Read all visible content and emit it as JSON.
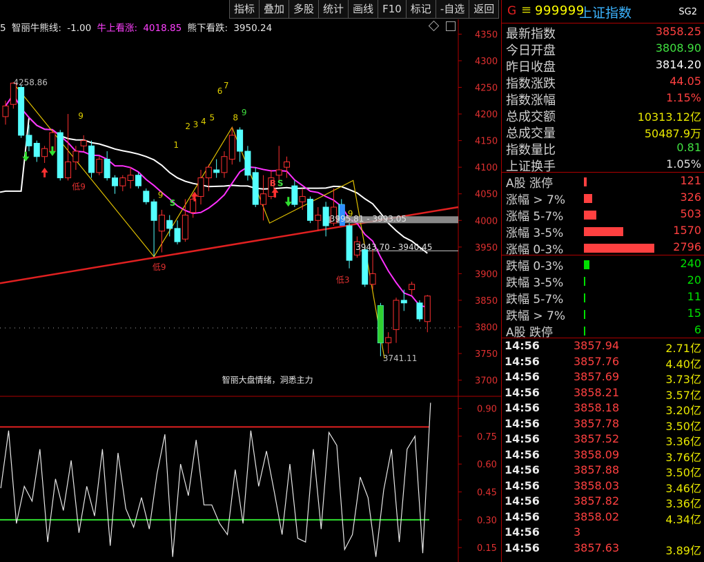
{
  "toolbar": [
    "指标",
    "叠加",
    "多股",
    "统计",
    "画线",
    "F10",
    "标记",
    "-自选",
    "返回"
  ],
  "legend": {
    "prefix": "5",
    "name": "智丽牛熊线:",
    "value": "-1.00",
    "bull_label": "牛上看涨:",
    "bull_value": "4018.85",
    "bear_label": "熊下看跌:",
    "bear_value": "3950.24"
  },
  "chart_data": {
    "type": "candlestick",
    "y_range": [
      3680,
      4370
    ],
    "y_ticks": [
      "4350",
      "4300",
      "4250",
      "4200",
      "4150",
      "4100",
      "4050",
      "4000",
      "3950",
      "3900",
      "3850",
      "3800",
      "3750",
      "3700"
    ],
    "candles": [
      [
        4195,
        4215,
        4180,
        4225
      ],
      [
        4218,
        4258,
        4210,
        4260
      ],
      [
        4250,
        4160,
        4155,
        4255
      ],
      [
        4160,
        4140,
        4130,
        4180
      ],
      [
        4145,
        4120,
        4110,
        4150
      ],
      [
        4120,
        4135,
        4108,
        4140
      ],
      [
        4130,
        4165,
        4125,
        4170
      ],
      [
        4165,
        4080,
        4075,
        4170
      ],
      [
        4080,
        4110,
        4075,
        4200
      ],
      [
        4110,
        4130,
        4095,
        4140
      ],
      [
        4140,
        4150,
        4130,
        4160
      ],
      [
        4140,
        4090,
        4080,
        4150
      ],
      [
        4090,
        4115,
        4085,
        4120
      ],
      [
        4115,
        4080,
        4075,
        4130
      ],
      [
        4080,
        4065,
        4050,
        4085
      ],
      [
        4065,
        4080,
        4055,
        4085
      ],
      [
        4075,
        4085,
        4060,
        4100
      ],
      [
        4085,
        4065,
        4060,
        4090
      ],
      [
        4055,
        4035,
        4030,
        4060
      ],
      [
        4035,
        4000,
        3932,
        4040
      ],
      [
        3980,
        4010,
        3940,
        4020
      ],
      [
        4000,
        3985,
        3970,
        4010
      ],
      [
        3985,
        3960,
        3955,
        4000
      ],
      [
        3965,
        4010,
        3960,
        4040
      ],
      [
        4015,
        4040,
        4005,
        4050
      ],
      [
        4045,
        4080,
        4030,
        4095
      ],
      [
        4080,
        4100,
        4055,
        4105
      ],
      [
        4095,
        4090,
        4080,
        4115
      ],
      [
        4090,
        4120,
        4080,
        4130
      ],
      [
        4115,
        4160,
        4105,
        4175
      ],
      [
        4170,
        4130,
        4110,
        4175
      ],
      [
        4130,
        4085,
        4075,
        4140
      ],
      [
        4090,
        4030,
        4025,
        4100
      ],
      [
        4030,
        4050,
        4000,
        4085
      ],
      [
        4045,
        4080,
        4040,
        4095
      ],
      [
        4085,
        4095,
        4070,
        4140
      ],
      [
        4100,
        4110,
        4080,
        4120
      ],
      [
        4065,
        4030,
        4025,
        4075
      ],
      [
        4035,
        4045,
        4020,
        4060
      ],
      [
        4040,
        4000,
        3995,
        4045
      ],
      [
        4000,
        4010,
        3980,
        4025
      ],
      [
        4025,
        3990,
        3970,
        4035
      ],
      [
        3995,
        4025,
        3990,
        4060
      ],
      [
        4030,
        4000,
        3995,
        4040
      ],
      [
        3990,
        3925,
        3910,
        3995
      ],
      [
        3935,
        3960,
        3930,
        3970
      ],
      [
        3945,
        3880,
        3875,
        3950
      ],
      [
        3880,
        3900,
        3870,
        3945
      ],
      [
        3840,
        3770,
        3745,
        3845
      ],
      [
        3770,
        3780,
        3750,
        3790
      ],
      [
        3795,
        3850,
        3770,
        3855
      ],
      [
        3850,
        3845,
        3830,
        3870
      ],
      [
        3870,
        3880,
        3860,
        3885
      ],
      [
        3845,
        3815,
        3810,
        3850
      ],
      [
        3810,
        3858,
        3790,
        3860
      ]
    ],
    "annotations": [
      {
        "text": "4258.86",
        "x": 1,
        "y": 4258.86,
        "color": "#c0c0c0"
      },
      {
        "text": "3995.81 - 3993.05",
        "x": 41.5,
        "y": 4003,
        "color": "#e0e0e0"
      },
      {
        "text": "3943.70 - 3940.45",
        "x": 44.8,
        "y": 3950,
        "color": "#e0e0e0"
      },
      {
        "text": "3741.11",
        "x": 48.3,
        "y": 3741.11,
        "color": "#c0c0c0"
      },
      {
        "text": "低9",
        "x": 18.8,
        "y": 3912,
        "color": "#e03030"
      },
      {
        "text": "低9",
        "x": 8.5,
        "y": 4063,
        "color": "#e03030"
      },
      {
        "text": "9",
        "x": 9.3,
        "y": 4196,
        "color": "#e0d000"
      },
      {
        "text": "1",
        "x": 21.5,
        "y": 4142,
        "color": "#e0d000"
      },
      {
        "text": "2",
        "x": 23.0,
        "y": 4177,
        "color": "#e0d000"
      },
      {
        "text": "3",
        "x": 24.0,
        "y": 4180,
        "color": "#e0d000"
      },
      {
        "text": "4",
        "x": 25.0,
        "y": 4186,
        "color": "#e0d000"
      },
      {
        "text": "5",
        "x": 26.1,
        "y": 4193,
        "color": "#e0d000"
      },
      {
        "text": "6",
        "x": 27.1,
        "y": 4243,
        "color": "#e0d000"
      },
      {
        "text": "7",
        "x": 27.9,
        "y": 4253,
        "color": "#e0d000"
      },
      {
        "text": "8",
        "x": 29.1,
        "y": 4193,
        "color": "#e0d000"
      },
      {
        "text": "9",
        "x": 30.2,
        "y": 4203,
        "color": "#40e040"
      },
      {
        "text": "9",
        "x": 19.5,
        "y": 4048,
        "color": "#e0d000"
      },
      {
        "text": "9",
        "x": 43.8,
        "y": 4013,
        "color": "#e0d000"
      },
      {
        "text": "S",
        "x": 21.0,
        "y": 4033,
        "color": "#40e040"
      },
      {
        "text": "B",
        "x": 33.8,
        "y": 4070,
        "color": "#ff4040"
      },
      {
        "text": "S",
        "x": 34.8,
        "y": 4070,
        "color": "#40e040"
      },
      {
        "text": "低3",
        "x": 42.3,
        "y": 3888,
        "color": "#e03030"
      },
      {
        "text": "智丽大盘情绪，洞悉主力",
        "x": 27.7,
        "y": 3700,
        "color": "#e8e8e8"
      }
    ],
    "indicator": {
      "y_range": [
        0.08,
        0.95
      ],
      "y_ticks": [
        "0.90",
        "0.75",
        "0.60",
        "0.45",
        "0.30",
        "0.15"
      ],
      "upper_line": 0.8,
      "lower_line": 0.3,
      "values": [
        0.47,
        0.78,
        0.28,
        0.48,
        0.4,
        0.68,
        0.18,
        0.52,
        0.35,
        0.62,
        0.23,
        0.48,
        0.32,
        0.68,
        0.16,
        0.66,
        0.36,
        0.26,
        0.42,
        0.25,
        0.55,
        0.76,
        0.1,
        0.6,
        0.43,
        0.73,
        0.38,
        0.38,
        0.28,
        0.22,
        0.57,
        0.28,
        0.78,
        0.48,
        0.67,
        0.45,
        0.22,
        0.6,
        0.2,
        0.18,
        0.68,
        0.25,
        0.77,
        0.7,
        0.14,
        0.22,
        0.53,
        0.42,
        0.1,
        0.46,
        0.68,
        0.18,
        0.68,
        0.75,
        0.12,
        0.93
      ]
    }
  },
  "panel": {
    "code": "999999",
    "name": "上证指数",
    "badge": "SG2",
    "stats": [
      {
        "label": "最新指数",
        "value": "3858.25",
        "color": "#ff4040"
      },
      {
        "label": "今日开盘",
        "value": "3808.90",
        "color": "#40e040"
      },
      {
        "label": "昨日收盘",
        "value": "3814.20",
        "color": "#ffffff"
      },
      {
        "label": "指数涨跌",
        "value": "44.05",
        "color": "#ff4040"
      },
      {
        "label": "指数涨幅",
        "value": "1.15%",
        "color": "#ff4040"
      },
      {
        "label": "总成交额",
        "value": "10313.12亿",
        "color": "#e8e800"
      },
      {
        "label": "总成交量",
        "value": "50487.9万",
        "color": "#e8e800"
      },
      {
        "label": "指数量比",
        "value": "0.81",
        "color": "#40e040"
      },
      {
        "label": "上证换手",
        "value": "1.05%",
        "color": "#e0e0e0"
      }
    ],
    "up_breakdown": [
      {
        "label": "A股 涨停",
        "value": "121",
        "bar": 0.04
      },
      {
        "label": "涨幅 > 7%",
        "value": "326",
        "bar": 0.12
      },
      {
        "label": "涨幅 5-7%",
        "value": "503",
        "bar": 0.18
      },
      {
        "label": "涨幅 3-5%",
        "value": "1570",
        "bar": 0.56
      },
      {
        "label": "涨幅 0-3%",
        "value": "2796",
        "bar": 1.0
      }
    ],
    "down_breakdown": [
      {
        "label": "跌幅 0-3%",
        "value": "240",
        "bar": 0.08
      },
      {
        "label": "跌幅 3-5%",
        "value": "20",
        "bar": 0.01
      },
      {
        "label": "跌幅 5-7%",
        "value": "11",
        "bar": 0.01
      },
      {
        "label": "跌幅 > 7%",
        "value": "15",
        "bar": 0.01
      },
      {
        "label": "A股 跌停",
        "value": "6",
        "bar": 0.01
      }
    ],
    "ticks": [
      {
        "time": "14:56",
        "price": "3857.94",
        "vol": "2.71亿"
      },
      {
        "time": "14:56",
        "price": "3857.76",
        "vol": "4.40亿"
      },
      {
        "time": "14:56",
        "price": "3857.69",
        "vol": "3.73亿"
      },
      {
        "time": "14:56",
        "price": "3858.21",
        "vol": "3.57亿"
      },
      {
        "time": "14:56",
        "price": "3858.18",
        "vol": "3.20亿"
      },
      {
        "time": "14:56",
        "price": "3857.78",
        "vol": "3.50亿"
      },
      {
        "time": "14:56",
        "price": "3857.52",
        "vol": "3.36亿"
      },
      {
        "time": "14:56",
        "price": "3858.09",
        "vol": "3.76亿"
      },
      {
        "time": "14:56",
        "price": "3857.88",
        "vol": "3.50亿"
      },
      {
        "time": "14:56",
        "price": "3858.03",
        "vol": "3.46亿"
      },
      {
        "time": "14:56",
        "price": "3857.82",
        "vol": "3.36亿"
      },
      {
        "time": "14:56",
        "price": "3858.02",
        "vol": "4.34亿"
      },
      {
        "time": "14:56",
        "price": "3",
        "vol": ""
      },
      {
        "time": "14:56",
        "price": "3857.63",
        "vol": "3.89亿"
      }
    ],
    "colors": {
      "up": "#ff4040",
      "down": "#00e000",
      "separator": "#b00000"
    }
  }
}
